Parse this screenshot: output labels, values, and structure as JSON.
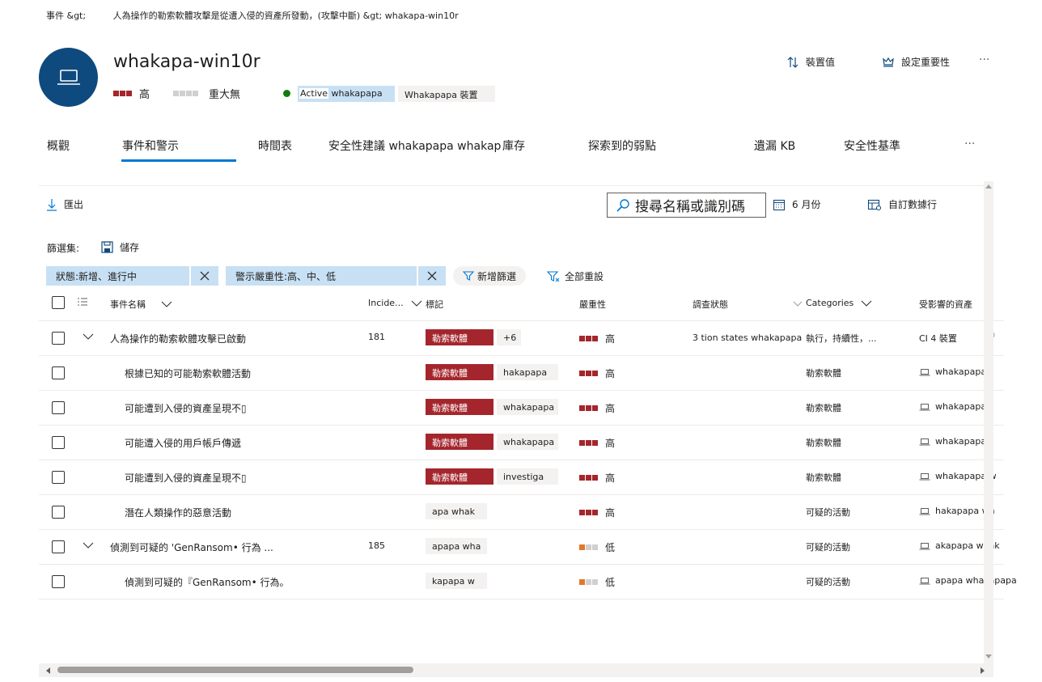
{
  "breadcrumb": {
    "root": "事件 &gt;",
    "current": "人為操作的勒索軟體攻擊是從遭入侵的資產所發動，(攻擊中斷) &gt; whakapa-win10r"
  },
  "device": {
    "name": "whakapa-win10r",
    "risk_label": "高",
    "criticality_label": "重大無",
    "status_prefix": "Active",
    "status_highlight": "whakapapa",
    "device_tag": "Whakapapa 裝置"
  },
  "header_actions": {
    "device_value": "裝置值",
    "set_criticality": "設定重要性",
    "more": "···"
  },
  "tabs": [
    {
      "label": "概觀"
    },
    {
      "label": "事件和警示"
    },
    {
      "label": "時間表"
    },
    {
      "label": "安全性建議 whakapapa whakap"
    },
    {
      "label": "庫存"
    },
    {
      "label": "探索到的弱點"
    },
    {
      "label": "遺漏 KB"
    },
    {
      "label": "安全性基準"
    },
    {
      "label": "···"
    }
  ],
  "toolbar": {
    "export": "匯出",
    "search_placeholder": "搜尋名稱或識別碼",
    "date_range": "6 月份",
    "custom_columns": "自訂數據行"
  },
  "filters": {
    "label": "篩選集:",
    "save": "儲存",
    "chip_status": "狀態:新增、進行中",
    "chip_severity": "警示嚴重性:高、中、低",
    "add_filter": "新增篩選",
    "reset_all": "全部重設"
  },
  "table": {
    "headers": {
      "name": "事件名稱",
      "incident": "Incide...",
      "tags": "標記",
      "severity": "嚴重性",
      "investigation": "調查狀態",
      "categories": "Categories",
      "assets": "受影響的資產"
    },
    "rows": [
      {
        "name": "人為操作的勒索軟體攻擊已啟動",
        "incident": "181",
        "tag": "勒索軟體",
        "tag2": "+6",
        "severity": "高",
        "investigation": "3 tion states whakapapa",
        "category": "執行，持續性，...",
        "asset": "CI 4 裝置"
      },
      {
        "name": "根據已知的可能勒索軟體活動",
        "incident": "",
        "tag": "勒索軟體",
        "tag2": "hakapapa",
        "severity": "高",
        "investigation": "",
        "category": "勒索軟體",
        "asset": "whakapapa"
      },
      {
        "name": "可能遭到入侵的資產呈現不▯",
        "incident": "",
        "tag": "勒索軟體",
        "tag2": "whakapapa",
        "severity": "高",
        "investigation": "",
        "category": "勒索軟體",
        "asset": "whakapapa"
      },
      {
        "name": "可能遭入侵的用戶帳戶傳遞",
        "incident": "",
        "tag": "勒索軟體",
        "tag2": "whakapapa",
        "severity": "高",
        "investigation": "",
        "category": "勒索軟體",
        "asset": "whakapapa"
      },
      {
        "name": "可能遭到入侵的資產呈現不▯",
        "incident": "",
        "tag": "勒索軟體",
        "tag2": "investiga",
        "severity": "高",
        "investigation": "",
        "category": "勒索軟體",
        "asset": "whakapapa w"
      },
      {
        "name": "潛在人類操作的惡意活動",
        "incident": "",
        "tag": "",
        "tag2": "apa whak",
        "severity": "高",
        "investigation": "",
        "category": "可疑的活動",
        "asset": "hakapapa wh"
      },
      {
        "name": "偵測到可疑的 'GenRansom• 行為 ...",
        "incident": "185",
        "tag": "",
        "tag2": "apapa wha",
        "severity": "低",
        "investigation": "",
        "category": "可疑的活動",
        "asset": "akapapa whak"
      },
      {
        "name": "偵測到可疑的『GenRansom• 行為。",
        "incident": "",
        "tag": "",
        "tag2": "kapapa w",
        "severity": "低",
        "investigation": "",
        "category": "可疑的活動",
        "asset": "apapa whakapapa"
      }
    ]
  },
  "colors": {
    "accent": "#0078d4",
    "avatar": "#0f4a7e",
    "severity_high": "#a4262c",
    "severity_low": "#e3772c",
    "status_active": "#107c10"
  }
}
